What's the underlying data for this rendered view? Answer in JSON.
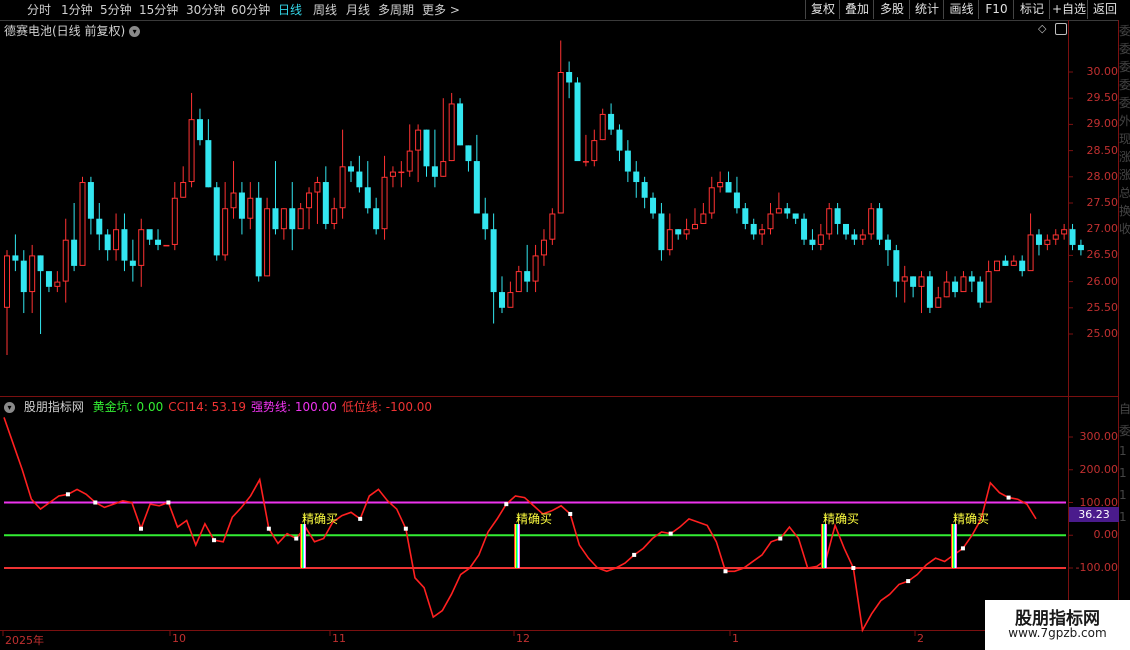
{
  "toolbar": {
    "periods": [
      "分时",
      "1分钟",
      "5分钟",
      "15分钟",
      "30分钟",
      "60分钟",
      "日线",
      "周线",
      "月线",
      "多周期",
      "更多 >"
    ],
    "active_period": "日线",
    "right_buttons": [
      "复权",
      "叠加",
      "多股",
      "统计",
      "画线",
      "F10",
      "标记",
      "+自选",
      "返回"
    ]
  },
  "main_chart": {
    "title": "德赛电池(日线 前复权)",
    "price_ticks": [
      "30.00",
      "29.50",
      "29.00",
      "28.50",
      "28.00",
      "27.50",
      "27.00",
      "26.50",
      "26.00",
      "25.50",
      "25.00"
    ]
  },
  "indicator": {
    "name": "股朋指标网",
    "legend": [
      {
        "text": "黄金坑: 0.00",
        "color": "#33ee33"
      },
      {
        "text": "CCI14: 53.19",
        "color": "#ee3333"
      },
      {
        "text": "强势线: 100.00",
        "color": "#ee33ee"
      },
      {
        "text": "低位线: -100.00",
        "color": "#ee3333"
      }
    ],
    "y_ticks": [
      "300.00",
      "200.00",
      "100.00",
      "0.00",
      "-100.00"
    ],
    "current_value": "36.23",
    "signal_label": "精确买"
  },
  "dates": [
    "2025年",
    "10",
    "11",
    "12",
    "1",
    "2"
  ],
  "right_strip_chars": [
    "委",
    "委",
    "委",
    "委",
    "委",
    "外",
    "现",
    "涨",
    "涨",
    "总",
    "换",
    "收",
    "自",
    "委",
    "1",
    "1",
    "1",
    "1"
  ],
  "watermark": {
    "line1": "股朋指标网",
    "line2": "www.7gpzb.com"
  },
  "colors": {
    "up": "#ff3333",
    "down": "#33e6f0",
    "strong": "#ee33ee",
    "gold": "#33ee33",
    "low": "#ee3333"
  },
  "chart_data": [
    {
      "type": "candlestick",
      "title": "德赛电池(日线 前复权)",
      "ylim": [
        24.3,
        30.6
      ],
      "candles": [
        [
          25.5,
          26.5,
          26.6,
          24.6
        ],
        [
          26.5,
          26.4,
          26.9,
          26.2
        ],
        [
          26.4,
          25.8,
          26.6,
          25.4
        ],
        [
          25.8,
          26.5,
          26.7,
          25.4
        ],
        [
          26.5,
          26.2,
          26.5,
          25.0
        ],
        [
          26.2,
          25.9,
          26.1,
          25.8
        ],
        [
          25.9,
          26.0,
          26.2,
          25.8
        ],
        [
          26.0,
          26.8,
          27.2,
          25.6
        ],
        [
          26.8,
          26.3,
          27.5,
          26.2
        ],
        [
          26.3,
          27.9,
          28.0,
          26.5
        ],
        [
          27.9,
          27.2,
          28.0,
          26.9
        ],
        [
          27.2,
          26.9,
          27.5,
          26.6
        ],
        [
          26.9,
          26.6,
          27.0,
          26.4
        ],
        [
          26.6,
          27.0,
          27.3,
          26.4
        ],
        [
          27.0,
          26.4,
          27.3,
          26.2
        ],
        [
          26.4,
          26.3,
          26.8,
          26.0
        ],
        [
          26.3,
          27.0,
          27.2,
          25.9
        ],
        [
          27.0,
          26.8,
          26.9,
          26.7
        ],
        [
          26.8,
          26.7,
          27.0,
          26.6
        ],
        [
          26.7,
          26.7,
          26.7,
          26.7
        ],
        [
          26.7,
          27.6,
          27.9,
          26.6
        ],
        [
          27.6,
          27.9,
          28.2,
          27.6
        ],
        [
          27.9,
          29.1,
          29.6,
          27.8
        ],
        [
          29.1,
          28.7,
          29.3,
          28.6
        ],
        [
          28.7,
          27.8,
          29.1,
          27.8
        ],
        [
          27.8,
          26.5,
          27.9,
          26.4
        ],
        [
          26.5,
          27.4,
          27.9,
          26.4
        ],
        [
          27.4,
          27.7,
          28.3,
          27.2
        ],
        [
          27.7,
          27.2,
          27.9,
          26.9
        ],
        [
          27.2,
          27.6,
          27.9,
          27.0
        ],
        [
          27.6,
          26.1,
          27.9,
          26.0
        ],
        [
          26.1,
          27.4,
          27.6,
          26.1
        ],
        [
          27.4,
          27.0,
          28.3,
          26.9
        ],
        [
          27.0,
          27.4,
          27.4,
          26.8
        ],
        [
          27.4,
          27.0,
          27.9,
          26.6
        ],
        [
          27.0,
          27.4,
          27.5,
          27.2
        ],
        [
          27.4,
          27.7,
          27.8,
          27.0
        ],
        [
          27.7,
          27.9,
          28.0,
          27.1
        ],
        [
          27.9,
          27.1,
          28.2,
          27.0
        ],
        [
          27.1,
          27.4,
          27.6,
          27.0
        ],
        [
          27.4,
          28.2,
          28.9,
          27.2
        ],
        [
          28.2,
          28.1,
          28.3,
          27.9
        ],
        [
          28.1,
          27.8,
          28.4,
          27.7
        ],
        [
          27.8,
          27.4,
          28.3,
          27.3
        ],
        [
          27.4,
          27.0,
          27.6,
          26.9
        ],
        [
          27.0,
          28.0,
          28.4,
          26.8
        ],
        [
          28.0,
          28.1,
          28.2,
          27.8
        ],
        [
          28.1,
          28.1,
          28.3,
          27.8
        ],
        [
          28.1,
          28.5,
          29.0,
          28.0
        ],
        [
          28.5,
          28.9,
          29.0,
          27.9
        ],
        [
          28.9,
          28.2,
          28.9,
          28.0
        ],
        [
          28.2,
          28.0,
          28.9,
          27.8
        ],
        [
          28.0,
          28.3,
          29.5,
          28.0
        ],
        [
          28.3,
          29.4,
          29.6,
          28.3
        ],
        [
          29.4,
          28.6,
          29.5,
          28.6
        ],
        [
          28.6,
          28.3,
          28.6,
          28.1
        ],
        [
          28.3,
          27.3,
          28.8,
          27.3
        ],
        [
          27.3,
          27.0,
          27.6,
          26.8
        ],
        [
          27.0,
          25.8,
          27.3,
          25.2
        ],
        [
          25.8,
          25.5,
          26.1,
          25.4
        ],
        [
          25.5,
          25.8,
          26.0,
          25.6
        ],
        [
          25.8,
          26.2,
          26.3,
          25.9
        ],
        [
          26.2,
          26.0,
          26.7,
          25.8
        ],
        [
          26.0,
          26.5,
          26.7,
          25.8
        ],
        [
          26.5,
          26.8,
          27.0,
          26.3
        ],
        [
          26.8,
          27.3,
          27.4,
          26.7
        ],
        [
          27.3,
          30.0,
          30.6,
          27.3
        ],
        [
          30.0,
          29.8,
          30.2,
          29.5
        ],
        [
          29.8,
          28.3,
          29.9,
          28.4
        ],
        [
          28.3,
          28.3,
          28.8,
          28.2
        ],
        [
          28.3,
          28.7,
          28.9,
          28.2
        ],
        [
          28.7,
          29.2,
          29.3,
          28.7
        ],
        [
          29.2,
          28.9,
          29.4,
          28.8
        ],
        [
          28.9,
          28.5,
          29.0,
          28.3
        ],
        [
          28.5,
          28.1,
          28.7,
          27.9
        ],
        [
          28.1,
          27.9,
          28.3,
          27.6
        ],
        [
          27.9,
          27.6,
          28.0,
          27.4
        ],
        [
          27.6,
          27.3,
          27.7,
          27.2
        ],
        [
          27.3,
          26.6,
          27.5,
          26.4
        ],
        [
          26.6,
          27.0,
          27.3,
          26.5
        ],
        [
          27.0,
          26.9,
          27.0,
          26.8
        ],
        [
          26.9,
          27.0,
          27.2,
          26.8
        ],
        [
          27.0,
          27.1,
          27.4,
          27.0
        ],
        [
          27.1,
          27.3,
          27.5,
          27.2
        ],
        [
          27.3,
          27.8,
          28.0,
          27.2
        ],
        [
          27.8,
          27.9,
          28.1,
          27.7
        ],
        [
          27.9,
          27.7,
          28.1,
          27.7
        ],
        [
          27.7,
          27.4,
          28.0,
          27.3
        ],
        [
          27.4,
          27.1,
          27.5,
          27.0
        ],
        [
          27.1,
          26.9,
          27.2,
          26.8
        ],
        [
          26.9,
          27.0,
          27.1,
          26.7
        ],
        [
          27.0,
          27.3,
          27.5,
          26.9
        ],
        [
          27.3,
          27.4,
          27.7,
          27.3
        ],
        [
          27.4,
          27.3,
          27.5,
          27.2
        ],
        [
          27.3,
          27.2,
          27.3,
          27.1
        ],
        [
          27.2,
          26.8,
          27.3,
          26.7
        ],
        [
          26.8,
          26.7,
          27.0,
          26.6
        ],
        [
          26.7,
          26.9,
          27.1,
          26.6
        ],
        [
          26.9,
          27.4,
          27.5,
          26.8
        ],
        [
          27.4,
          27.1,
          27.5,
          26.9
        ],
        [
          27.1,
          26.9,
          27.1,
          26.8
        ],
        [
          26.9,
          26.8,
          27.0,
          26.7
        ],
        [
          26.8,
          26.9,
          27.0,
          26.7
        ],
        [
          26.9,
          27.4,
          27.5,
          26.8
        ],
        [
          27.4,
          26.8,
          27.5,
          26.7
        ],
        [
          26.8,
          26.6,
          26.9,
          26.3
        ],
        [
          26.6,
          26.0,
          26.7,
          25.7
        ],
        [
          26.0,
          26.1,
          26.3,
          25.6
        ],
        [
          26.1,
          25.9,
          26.1,
          25.7
        ],
        [
          25.9,
          26.1,
          26.2,
          25.4
        ],
        [
          26.1,
          25.5,
          26.2,
          25.4
        ],
        [
          25.5,
          25.7,
          25.9,
          25.5
        ],
        [
          25.7,
          26.0,
          26.2,
          25.7
        ],
        [
          26.0,
          25.8,
          26.1,
          25.7
        ],
        [
          25.8,
          26.1,
          26.2,
          25.9
        ],
        [
          26.1,
          26.0,
          26.2,
          25.8
        ],
        [
          26.0,
          25.6,
          26.1,
          25.5
        ],
        [
          25.6,
          26.2,
          26.4,
          25.6
        ],
        [
          26.2,
          26.4,
          26.4,
          26.2
        ],
        [
          26.4,
          26.3,
          26.5,
          26.3
        ],
        [
          26.3,
          26.4,
          26.5,
          26.3
        ],
        [
          26.4,
          26.2,
          26.5,
          26.1
        ],
        [
          26.2,
          26.9,
          27.3,
          26.3
        ],
        [
          26.9,
          26.7,
          27.0,
          26.5
        ],
        [
          26.7,
          26.8,
          26.9,
          26.6
        ],
        [
          26.8,
          26.9,
          27.0,
          26.7
        ],
        [
          26.9,
          27.0,
          27.1,
          26.8
        ],
        [
          27.0,
          26.7,
          27.1,
          26.6
        ],
        [
          26.7,
          26.6,
          26.8,
          26.5
        ]
      ]
    },
    {
      "type": "line",
      "title": "股朋指标网",
      "ylim": [
        -270,
        370
      ],
      "series": [
        {
          "name": "CCI14",
          "values": [
            360,
            280,
            200,
            110,
            80,
            100,
            120,
            125,
            140,
            125,
            100,
            85,
            95,
            105,
            100,
            20,
            95,
            90,
            100,
            25,
            45,
            -30,
            35,
            -15,
            -20,
            55,
            85,
            120,
            170,
            20,
            -25,
            5,
            -10,
            25,
            -20,
            -10,
            40,
            60,
            70,
            50,
            120,
            140,
            105,
            80,
            20,
            -130,
            -160,
            -250,
            -230,
            -180,
            -120,
            -100,
            -60,
            10,
            50,
            95,
            120,
            115,
            90,
            65,
            75,
            90,
            65,
            -30,
            -70,
            -100,
            -110,
            -100,
            -85,
            -60,
            -40,
            -10,
            10,
            5,
            25,
            50,
            40,
            30,
            -20,
            -110,
            -110,
            -100,
            -80,
            -60,
            -20,
            -10,
            25,
            -10,
            -100,
            -95,
            -75,
            30,
            -40,
            -100,
            -290,
            -240,
            -200,
            -180,
            -150,
            -140,
            -120,
            -90,
            -70,
            -80,
            -60,
            -40,
            0,
            50,
            160,
            130,
            115,
            110,
            95,
            50
          ]
        },
        {
          "name": "强势线",
          "values": [
            100
          ]
        },
        {
          "name": "黄金坑",
          "values": [
            0
          ]
        },
        {
          "name": "低位线",
          "values": [
            -100
          ]
        }
      ]
    }
  ]
}
